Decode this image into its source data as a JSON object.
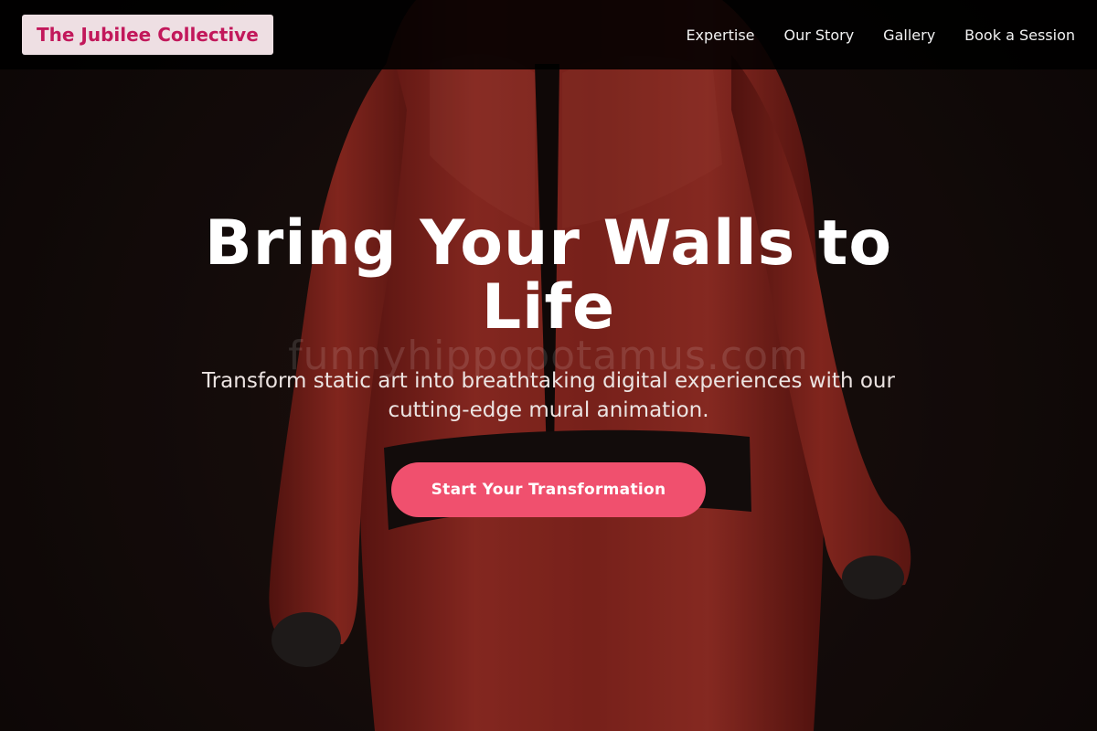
{
  "brand": {
    "name": "The Jubilee Collective"
  },
  "nav": {
    "links": [
      {
        "label": "Expertise"
      },
      {
        "label": "Our Story"
      },
      {
        "label": "Gallery"
      },
      {
        "label": "Book a Session"
      }
    ]
  },
  "hero": {
    "title": "Bring Your Walls to Life",
    "subtitle": "Transform static art into breathtaking digital experiences with our cutting-edge mural animation.",
    "cta_label": "Start Your Transformation",
    "watermark": "funnyhippopotamus.com"
  },
  "colors": {
    "accent": "#f0506e",
    "brand_text": "#c2185b",
    "brand_bg": "#eedfe3",
    "nav_bg": "#000000",
    "figure": "#b5322a"
  }
}
